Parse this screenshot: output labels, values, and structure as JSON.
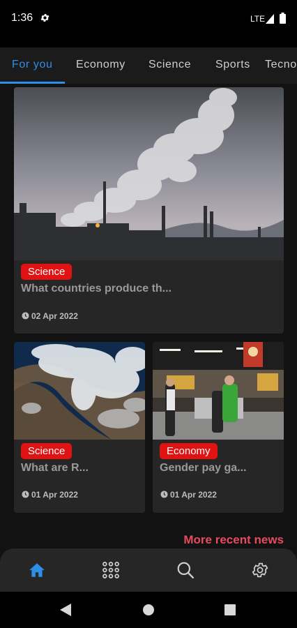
{
  "status_bar": {
    "time": "1:36",
    "network": "LTE"
  },
  "tabs": [
    {
      "label": "For you",
      "active": true
    },
    {
      "label": "Economy",
      "active": false
    },
    {
      "label": "Science",
      "active": false
    },
    {
      "label": "Sports",
      "active": false
    },
    {
      "label": "Tecnology",
      "active": false
    }
  ],
  "cards": [
    {
      "category": "Science",
      "title": "What countries produce th...",
      "date": "02 Apr 2022",
      "image": "industrial-smoke-photo"
    },
    {
      "category": "Science",
      "title": "What are R...",
      "date": "01 Apr 2022",
      "image": "satellite-storm-photo"
    },
    {
      "category": "Economy",
      "title": "Gender pay ga...",
      "date": "01 Apr 2022",
      "image": "supermarket-photo"
    }
  ],
  "more_link": "More recent news",
  "bottom_nav": [
    {
      "icon": "home-icon",
      "active": true
    },
    {
      "icon": "categories-grid-icon",
      "active": false
    },
    {
      "icon": "search-icon",
      "active": false
    },
    {
      "icon": "settings-icon",
      "active": false
    }
  ],
  "colors": {
    "accent": "#2e8ee8",
    "badge": "#e01212",
    "more_link": "#e84a5f",
    "background": "#121212",
    "card": "#262626"
  }
}
